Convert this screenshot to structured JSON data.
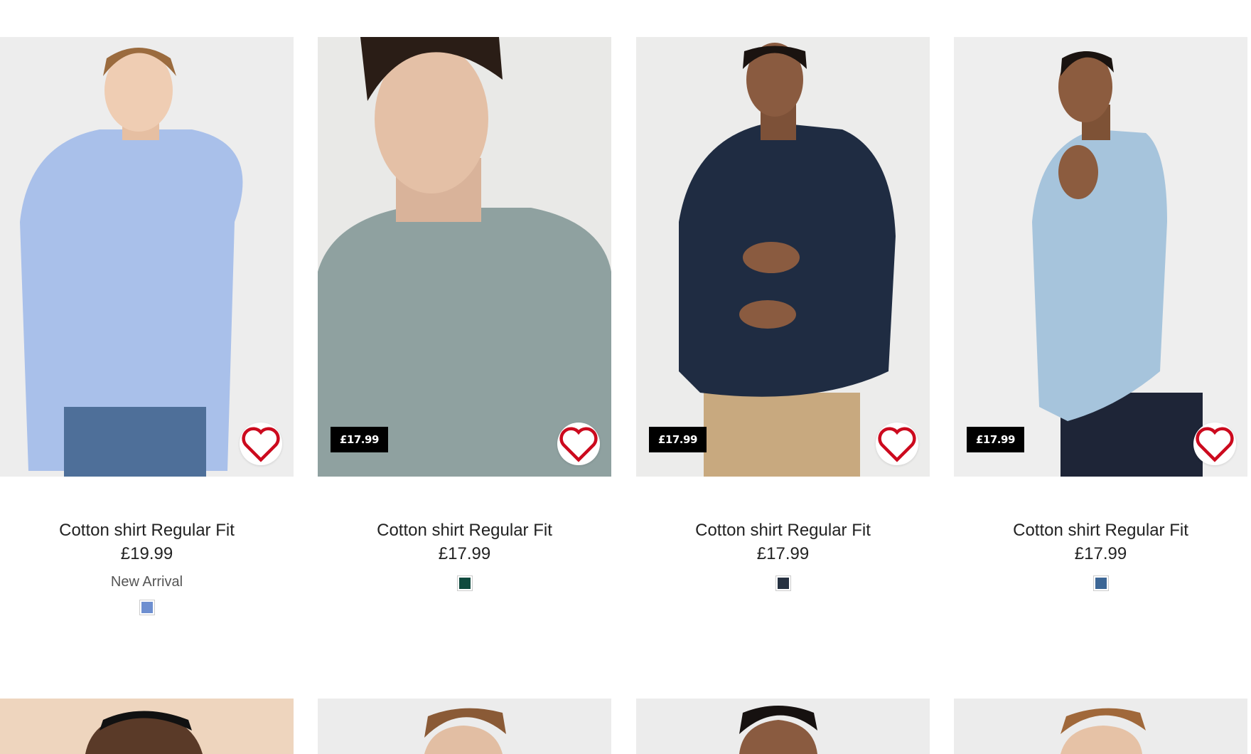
{
  "products": [
    {
      "title": "Cotton shirt Regular Fit",
      "price": "£19.99",
      "badge": "",
      "label": "New Arrival",
      "swatch": "#6e8fd0",
      "shirt": "#a9c0ea",
      "bg": "#ededed",
      "wishlist_icon": "heart-icon"
    },
    {
      "title": "Cotton shirt Regular Fit",
      "price": "£17.99",
      "badge": "£17.99",
      "label": "",
      "swatch": "#0f4a3e",
      "shirt": "#8fa1a0",
      "bg": "#e9e9e7",
      "wishlist_icon": "heart-icon"
    },
    {
      "title": "Cotton shirt Regular Fit",
      "price": "£17.99",
      "badge": "£17.99",
      "label": "",
      "swatch": "#263141",
      "shirt": "#1f2c42",
      "bg": "#ececeb",
      "wishlist_icon": "heart-icon"
    },
    {
      "title": "Cotton shirt Regular Fit",
      "price": "£17.99",
      "badge": "£17.99",
      "label": "",
      "swatch": "#3d6796",
      "shirt": "#a6c4dc",
      "bg": "#eeeeee",
      "wishlist_icon": "heart-icon"
    }
  ],
  "next_row": [
    {
      "bg": "#eed5be"
    },
    {
      "bg": "#ececec"
    },
    {
      "bg": "#ececec"
    },
    {
      "bg": "#ececec"
    }
  ],
  "colors": {
    "heart": "#cc0a1e",
    "badge_bg": "#000000",
    "text": "#222222"
  }
}
